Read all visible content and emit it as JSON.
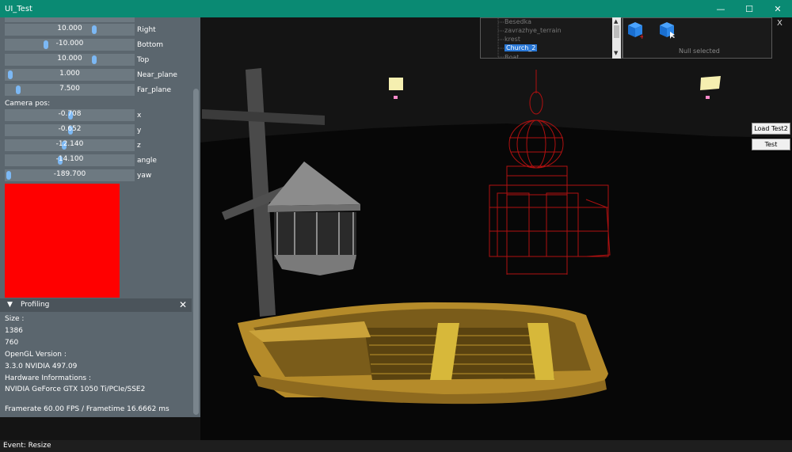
{
  "window": {
    "title": "UI_Test"
  },
  "camera_params": [
    {
      "value": "10.000",
      "label": "Right",
      "knob": 0.7
    },
    {
      "value": "-10.000",
      "label": "Bottom",
      "knob": 0.3
    },
    {
      "value": "10.000",
      "label": "Top",
      "knob": 0.7
    },
    {
      "value": "1.000",
      "label": "Near_plane",
      "knob": 0.02
    },
    {
      "value": "7.500",
      "label": "Far_plane",
      "knob": 0.1
    }
  ],
  "camera_pos": {
    "heading": "Camera pos:",
    "items": [
      {
        "value": "-0.708",
        "label": "x",
        "knob": 0.5
      },
      {
        "value": "-0.652",
        "label": "y",
        "knob": 0.5
      },
      {
        "value": "-12.140",
        "label": "z",
        "knob": 0.44
      },
      {
        "value": "-14.100",
        "label": "angle",
        "knob": 0.41
      },
      {
        "value": "-189.700",
        "label": "yaw",
        "knob": 0.01
      }
    ]
  },
  "color_swatch": "#ff0000",
  "profiling": {
    "header": "Profiling",
    "size_label": "Size :",
    "width": "1386",
    "height": "760",
    "opengl_label": "OpenGL Version :",
    "opengl_version": "3.3.0 NVIDIA 497.09",
    "hw_label": "Hardware Informations :",
    "hw_info": "NVIDIA GeForce GTX 1050 Ti/PCIe/SSE2",
    "framerate": "Framerate 60.00 FPS / Frametime 16.6662 ms"
  },
  "scene_tree": {
    "items": [
      "Besedka",
      "zavrazhye_terrain",
      "krest",
      "Church_2",
      "Boat"
    ],
    "selected": "Church_2"
  },
  "object_panel": {
    "status": "Null selected",
    "close": "X",
    "icons": [
      "add-cube-icon",
      "select-cube-icon"
    ]
  },
  "buttons": {
    "load": "Load Test2",
    "test": "Test"
  },
  "status": {
    "event": "Event: Resize"
  },
  "colors": {
    "titlebar": "#0a8a73",
    "panel": "#5b666e",
    "selected": "#2a78d6",
    "wireframe": "#b01010"
  }
}
